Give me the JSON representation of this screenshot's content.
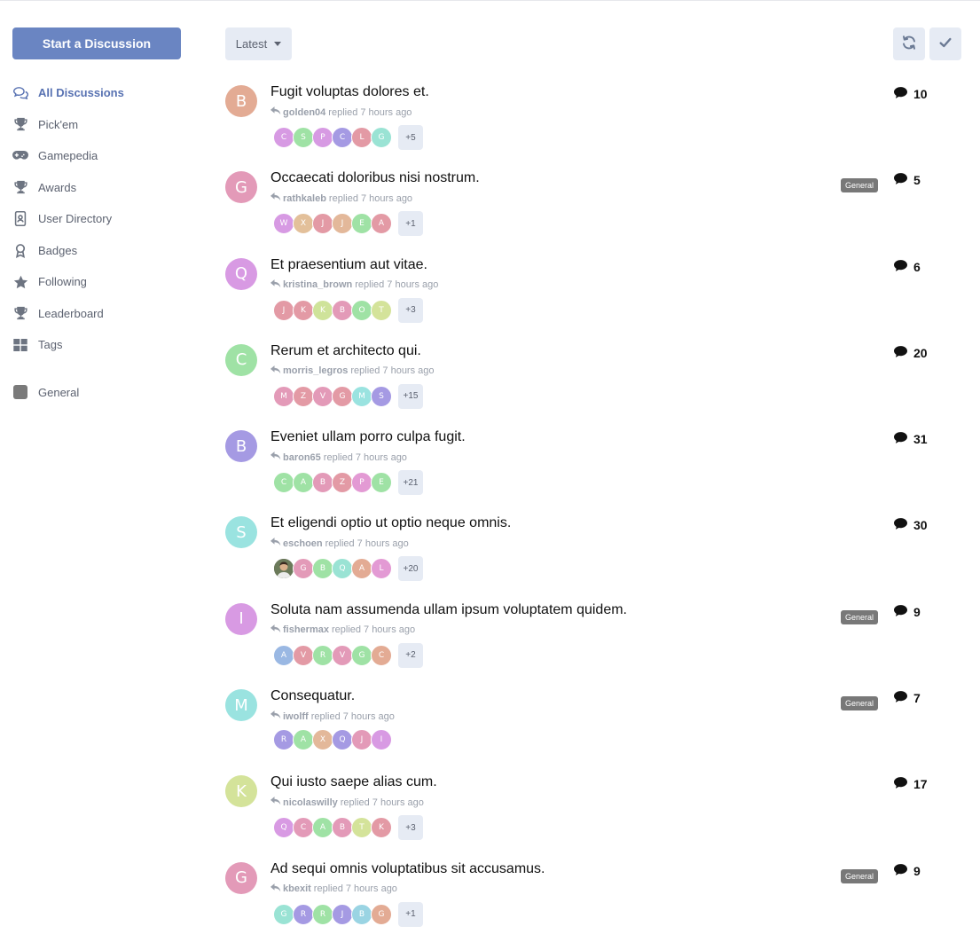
{
  "sidebar": {
    "start_label": "Start a Discussion",
    "nav": [
      {
        "label": "All Discussions",
        "icon": "comments-icon",
        "active": true
      },
      {
        "label": "Pick'em",
        "icon": "trophy-icon"
      },
      {
        "label": "Gamepedia",
        "icon": "gamepad-icon"
      },
      {
        "label": "Awards",
        "icon": "trophy-icon"
      },
      {
        "label": "User Directory",
        "icon": "address-book-icon"
      },
      {
        "label": "Badges",
        "icon": "award-icon"
      },
      {
        "label": "Following",
        "icon": "star-icon"
      },
      {
        "label": "Leaderboard",
        "icon": "trophy-icon"
      },
      {
        "label": "Tags",
        "icon": "grid-icon"
      }
    ],
    "tag": {
      "label": "General",
      "color": "#7a7a7a"
    }
  },
  "toolbar": {
    "sort_label": "Latest",
    "refresh_icon": "refresh-icon",
    "mark_read_icon": "check-icon"
  },
  "colors": {
    "accent": "#6a85c2",
    "badge": "#787878",
    "muted": "#9aa0ab"
  },
  "discussions": [
    {
      "title": "Fugit voluptas dolores et.",
      "author_initial": "B",
      "author_color": "#e3ab94",
      "user": "golden04",
      "action": "replied",
      "time": "7 hours ago",
      "count": "10",
      "tag": "",
      "participants": [
        {
          "i": "C",
          "c": "#d79ae3"
        },
        {
          "i": "S",
          "c": "#9fe2a5"
        },
        {
          "i": "P",
          "c": "#d79ae3"
        },
        {
          "i": "C",
          "c": "#a59ae3"
        },
        {
          "i": "L",
          "c": "#e39aa5"
        },
        {
          "i": "G",
          "c": "#9ae3d4"
        }
      ],
      "more": "+5"
    },
    {
      "title": "Occaecati doloribus nisi nostrum.",
      "author_initial": "G",
      "author_color": "#e39ab8",
      "user": "rathkaleb",
      "action": "replied",
      "time": "7 hours ago",
      "count": "5",
      "tag": "General",
      "participants": [
        {
          "i": "W",
          "c": "#d79ae3"
        },
        {
          "i": "X",
          "c": "#e3c09a"
        },
        {
          "i": "J",
          "c": "#e39aa5"
        },
        {
          "i": "J",
          "c": "#e3b89a"
        },
        {
          "i": "E",
          "c": "#9fe2a5"
        },
        {
          "i": "A",
          "c": "#e39aa5"
        }
      ],
      "more": "+1"
    },
    {
      "title": "Et praesentium aut vitae.",
      "author_initial": "Q",
      "author_color": "#d89ae3",
      "user": "kristina_brown",
      "action": "replied",
      "time": "7 hours ago",
      "count": "6",
      "tag": "",
      "participants": [
        {
          "i": "J",
          "c": "#e39aa5"
        },
        {
          "i": "K",
          "c": "#e39aa5"
        },
        {
          "i": "K",
          "c": "#cfe39a"
        },
        {
          "i": "B",
          "c": "#e39ab8"
        },
        {
          "i": "O",
          "c": "#9fe2a5"
        },
        {
          "i": "T",
          "c": "#d4e39a"
        }
      ],
      "more": "+3"
    },
    {
      "title": "Rerum et architecto qui.",
      "author_initial": "C",
      "author_color": "#9fe2a5",
      "user": "morris_legros",
      "action": "replied",
      "time": "7 hours ago",
      "count": "20",
      "tag": "",
      "participants": [
        {
          "i": "M",
          "c": "#e39ab8"
        },
        {
          "i": "Z",
          "c": "#e39aa5"
        },
        {
          "i": "V",
          "c": "#e39ab8"
        },
        {
          "i": "G",
          "c": "#e39aa5"
        },
        {
          "i": "M",
          "c": "#9ae3e0"
        },
        {
          "i": "S",
          "c": "#a59ae3"
        }
      ],
      "more": "+15"
    },
    {
      "title": "Eveniet ullam porro culpa fugit.",
      "author_initial": "B",
      "author_color": "#a59ae3",
      "user": "baron65",
      "action": "replied",
      "time": "7 hours ago",
      "count": "31",
      "tag": "",
      "participants": [
        {
          "i": "C",
          "c": "#9fe2a5"
        },
        {
          "i": "A",
          "c": "#9fe2a5"
        },
        {
          "i": "B",
          "c": "#e39ab8"
        },
        {
          "i": "Z",
          "c": "#e39aa5"
        },
        {
          "i": "P",
          "c": "#e39ad4"
        },
        {
          "i": "E",
          "c": "#9fe2a5"
        }
      ],
      "more": "+21"
    },
    {
      "title": "Et eligendi optio ut optio neque omnis.",
      "author_initial": "S",
      "author_color": "#9ae3e0",
      "user": "eschoen",
      "action": "replied",
      "time": "7 hours ago",
      "count": "30",
      "tag": "",
      "participants": [
        {
          "i": "",
          "c": "#5a5a5a",
          "photo": true
        },
        {
          "i": "G",
          "c": "#e39ab8"
        },
        {
          "i": "B",
          "c": "#9fe2a5"
        },
        {
          "i": "Q",
          "c": "#9ae3d4"
        },
        {
          "i": "A",
          "c": "#e3ab94"
        },
        {
          "i": "L",
          "c": "#e39ad4"
        }
      ],
      "more": "+20"
    },
    {
      "title": "Soluta nam assumenda ullam ipsum voluptatem quidem.",
      "author_initial": "I",
      "author_color": "#d89ae3",
      "user": "fishermax",
      "action": "replied",
      "time": "7 hours ago",
      "count": "9",
      "tag": "General",
      "participants": [
        {
          "i": "A",
          "c": "#9ab8e3"
        },
        {
          "i": "V",
          "c": "#e39aa5"
        },
        {
          "i": "R",
          "c": "#9fe2a5"
        },
        {
          "i": "V",
          "c": "#e39ab8"
        },
        {
          "i": "G",
          "c": "#9fe2a5"
        },
        {
          "i": "C",
          "c": "#e3ab94"
        }
      ],
      "more": "+2"
    },
    {
      "title": "Consequatur.",
      "author_initial": "M",
      "author_color": "#9ae3e0",
      "user": "iwolff",
      "action": "replied",
      "time": "7 hours ago",
      "count": "7",
      "tag": "General",
      "participants": [
        {
          "i": "R",
          "c": "#a59ae3"
        },
        {
          "i": "A",
          "c": "#9fe2a5"
        },
        {
          "i": "X",
          "c": "#e3b89a"
        },
        {
          "i": "Q",
          "c": "#a59ae3"
        },
        {
          "i": "J",
          "c": "#e39ab8"
        },
        {
          "i": "I",
          "c": "#d89ae3"
        }
      ],
      "more": ""
    },
    {
      "title": "Qui iusto saepe alias cum.",
      "author_initial": "K",
      "author_color": "#d4e39a",
      "user": "nicolaswilly",
      "action": "replied",
      "time": "7 hours ago",
      "count": "17",
      "tag": "",
      "participants": [
        {
          "i": "Q",
          "c": "#d89ae3"
        },
        {
          "i": "C",
          "c": "#e39ab8"
        },
        {
          "i": "A",
          "c": "#9fe2a5"
        },
        {
          "i": "B",
          "c": "#e39ab8"
        },
        {
          "i": "T",
          "c": "#d4e39a"
        },
        {
          "i": "K",
          "c": "#e39aa5"
        }
      ],
      "more": "+3"
    },
    {
      "title": "Ad sequi omnis voluptatibus sit accusamus.",
      "author_initial": "G",
      "author_color": "#e39ab8",
      "user": "kbexit",
      "action": "replied",
      "time": "7 hours ago",
      "count": "9",
      "tag": "General",
      "participants": [
        {
          "i": "G",
          "c": "#9ae3d4"
        },
        {
          "i": "R",
          "c": "#a59ae3"
        },
        {
          "i": "R",
          "c": "#9fe2a5"
        },
        {
          "i": "J",
          "c": "#a59ae3"
        },
        {
          "i": "B",
          "c": "#9ad4e3"
        },
        {
          "i": "G",
          "c": "#e3ab94"
        }
      ],
      "more": "+1"
    }
  ]
}
